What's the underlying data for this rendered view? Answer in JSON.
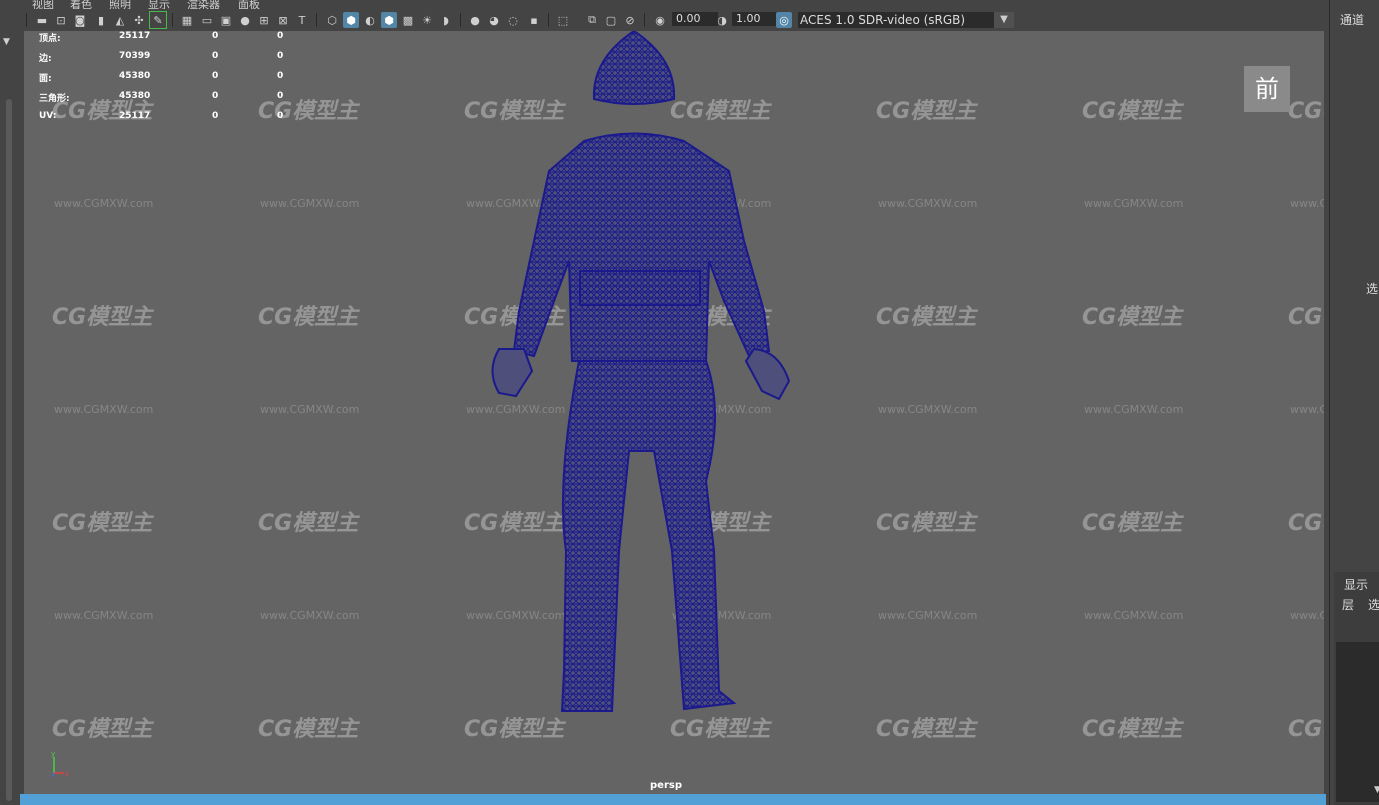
{
  "menu": {
    "items": [
      "视图",
      "着色",
      "照明",
      "显示",
      "渲染器",
      "面板"
    ]
  },
  "toolbar": {
    "exposure_value": "0.00",
    "gamma_value": "1.00",
    "color_space": "ACES 1.0 SDR-video (sRGB)"
  },
  "hud": {
    "rows": [
      {
        "label": "顶点:",
        "v1": "25117",
        "v2": "0",
        "v3": "0"
      },
      {
        "label": "边:",
        "v1": "70399",
        "v2": "0",
        "v3": "0"
      },
      {
        "label": "面:",
        "v1": "45380",
        "v2": "0",
        "v3": "0"
      },
      {
        "label": "三角形:",
        "v1": "45380",
        "v2": "0",
        "v3": "0"
      },
      {
        "label": "UV:",
        "v1": "25117",
        "v2": "0",
        "v3": "0"
      }
    ]
  },
  "viewport": {
    "camera_label": "前",
    "persp_label": "persp",
    "wireframe_color": "#1a1a8c",
    "background_color": "#646464"
  },
  "axis": {
    "y": "y",
    "x": "x",
    "z": "z"
  },
  "watermark": {
    "logo": "CG模型主",
    "url": "www.CGMXW.com"
  },
  "right_panel": {
    "channels": "通道",
    "select": "选",
    "display": "显示",
    "layer": "层",
    "select2": "选"
  },
  "colors": {
    "timeline": "#52a0d6",
    "active_button": "#5285a6"
  }
}
